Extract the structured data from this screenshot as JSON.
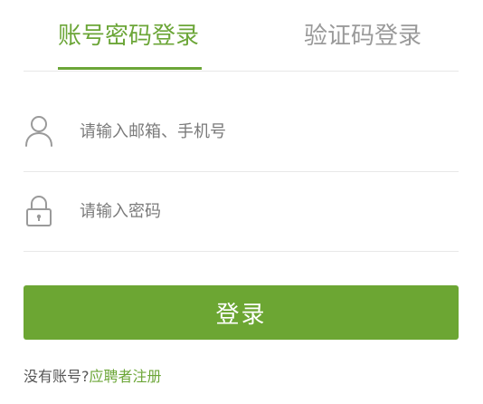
{
  "tabs": [
    {
      "label": "账号密码登录",
      "active": true
    },
    {
      "label": "验证码登录",
      "active": false
    }
  ],
  "account": {
    "placeholder": "请输入邮箱、手机号",
    "value": "",
    "icon": "user-icon"
  },
  "password": {
    "placeholder": "请输入密码",
    "value": "",
    "icon": "lock-icon"
  },
  "login_button": "登录",
  "register": {
    "prompt": "没有账号?",
    "link": "应聘者注册"
  },
  "colors": {
    "accent": "#6ca638",
    "button": "#6ca633",
    "inactive_tab": "#9a9a9a",
    "divider": "#e8e8e8"
  }
}
